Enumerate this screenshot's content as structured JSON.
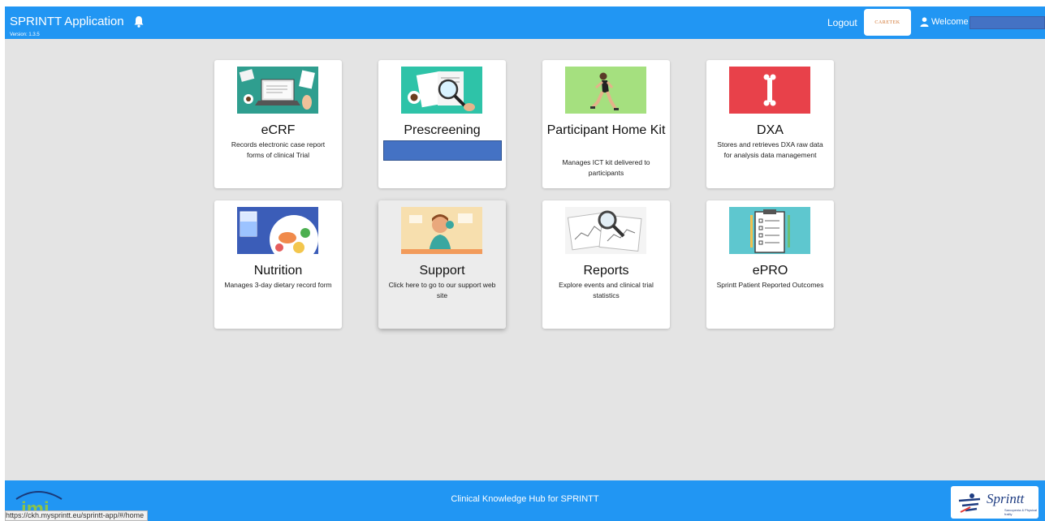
{
  "header": {
    "title": "SPRINTT Application",
    "version": "Version: 1.3.5",
    "logout_label": "Logout",
    "partner_logo_text": "CARETEK",
    "welcome_label": "Welcome"
  },
  "cards": [
    {
      "title": "eCRF",
      "description": "Records electronic case report forms of clinical Trial",
      "icon": "laptop-desk-illustration"
    },
    {
      "title": "Prescreening",
      "description": "",
      "icon": "magnifier-documents-illustration"
    },
    {
      "title": "Participant Home Kit",
      "description": "Manages ICT kit delivered to participants",
      "icon": "runner-illustration"
    },
    {
      "title": "DXA",
      "description": "Stores and retrieves DXA raw data for analysis data management",
      "icon": "bone-illustration"
    },
    {
      "title": "Nutrition",
      "description": "Manages 3-day dietary record form",
      "icon": "food-plate-illustration"
    },
    {
      "title": "Support",
      "description": "Click here to go to our support web site",
      "icon": "support-person-illustration"
    },
    {
      "title": "Reports",
      "description": "Explore events and clinical trial statistics",
      "icon": "magnifier-charts-illustration"
    },
    {
      "title": "ePRO",
      "description": "Sprintt Patient Reported Outcomes",
      "icon": "clipboard-checklist-illustration"
    }
  ],
  "footer": {
    "text": "Clinical Knowledge Hub for SPRINTT",
    "left_logo_text": "imi",
    "right_logo_name": "Sprintt",
    "right_logo_sub": "Sarcopenia & Physical frailty"
  },
  "status_bar": {
    "url": "https://ckh.mysprintt.eu/sprintt-app/#/home"
  },
  "colors": {
    "primary": "#2196f3",
    "background": "#e4e4e4",
    "redaction": "#4472c4"
  }
}
